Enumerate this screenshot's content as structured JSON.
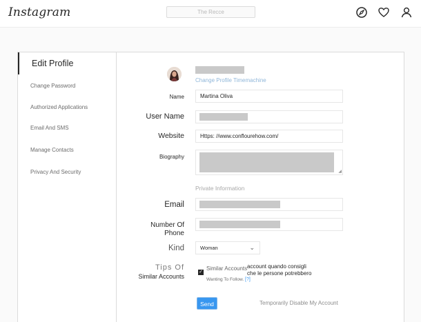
{
  "header": {
    "logo_text": "Instagram",
    "search_placeholder": "The Recce",
    "icons": [
      "compass-icon",
      "heart-icon",
      "profile-icon"
    ]
  },
  "sidebar": {
    "items": [
      {
        "label": "Edit Profile",
        "active": true
      },
      {
        "label": "Change Password",
        "active": false
      },
      {
        "label": "Authorized Applications",
        "active": false
      },
      {
        "label": "Email And SMS",
        "active": false
      },
      {
        "label": "Manage Contacts",
        "active": false
      },
      {
        "label": "Privacy And Security",
        "active": false
      }
    ]
  },
  "profile": {
    "change_photo_label": "Change Profile Timemachine"
  },
  "form": {
    "name_label": "Name",
    "name_value": "Martina Oliva",
    "username_label": "User Name",
    "website_label": "Website",
    "website_value": "Https: //www.conflourehow.com/",
    "bio_label": "Biography",
    "private_heading": "Private Information",
    "email_label": "Email",
    "phone_label": "Number Of Phone",
    "gender_label": "Kind",
    "gender_value": "Woman",
    "similar_label_line1": "Tips Of",
    "similar_label_line2": "Similar Accounts",
    "similar_checkbox_label": "Similar Accounts",
    "similar_checked": true,
    "consent_line1": "account quando consigli",
    "consent_line2": "che le persone potrebbero",
    "wanting_text": "Wanting To Follow.",
    "help_link": "[?]",
    "send_label": "Send",
    "disable_link": "Temporarily Disable My Account"
  },
  "colors": {
    "accent": "#3897f0",
    "border": "#dbdbdb",
    "text": "#262626",
    "muted": "#8e8e8e"
  }
}
